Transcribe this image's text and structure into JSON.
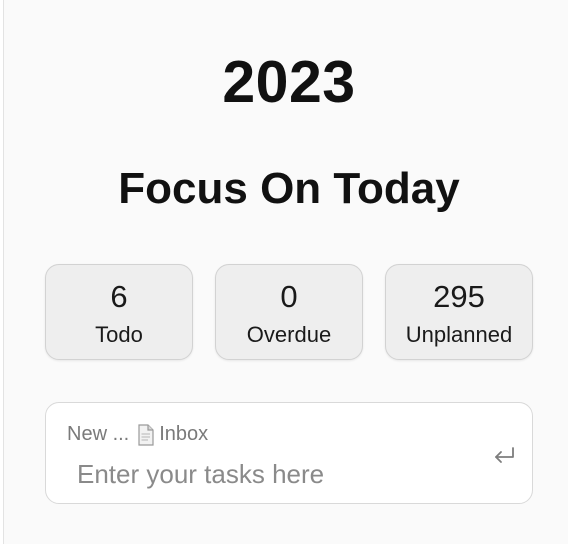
{
  "header": {
    "year": "2023",
    "title": "Focus On Today"
  },
  "stats": [
    {
      "value": "6",
      "label": "Todo"
    },
    {
      "value": "0",
      "label": "Overdue"
    },
    {
      "value": "295",
      "label": "Unplanned"
    }
  ],
  "task_input": {
    "mode_label": "New ...",
    "target_icon": "document-icon",
    "target_label": "Inbox",
    "placeholder": "Enter your tasks here",
    "value": "",
    "submit_icon": "enter-return-icon"
  }
}
